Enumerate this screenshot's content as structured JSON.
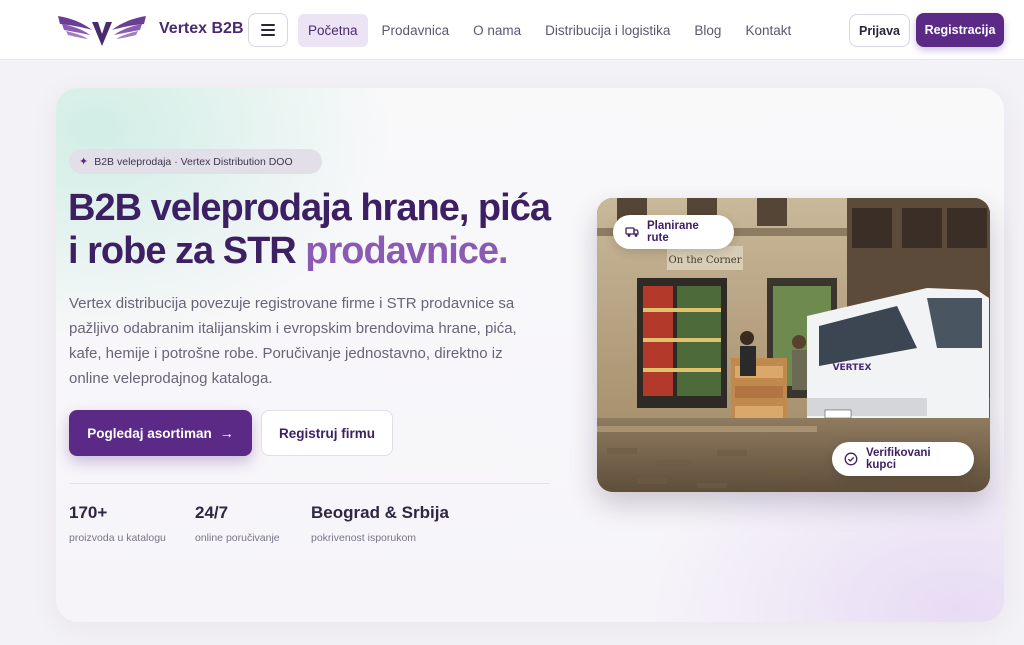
{
  "header": {
    "brand": "Vertex B2B",
    "logo_icon": "vertex-wings-logo",
    "menu_icon": "hamburger-icon",
    "nav": [
      {
        "label": "Početna",
        "active": true
      },
      {
        "label": "Prodavnica",
        "active": false
      },
      {
        "label": "O nama",
        "active": false
      },
      {
        "label": "Distribucija i logistika",
        "active": false
      },
      {
        "label": "Blog",
        "active": false
      },
      {
        "label": "Kontakt",
        "active": false
      }
    ],
    "login_label": "Prijava",
    "register_label": "Registracija"
  },
  "hero": {
    "badge": "B2B veleprodaja · Vertex Distribution DOO",
    "badge_icon": "sparkle-icon",
    "title_part1": "B2B veleprodaja hrane, pića i robe",
    "title_part2": "za STR",
    "title_accent": "prodavnice.",
    "lead": "Vertex distribucija povezuje registrovane firme i STR prodavnice sa pažljivo odabranim italijanskim i evropskim brendovima hrane, pića, kafe, hemije i potrošne robe. Poručivanje jednostavno, direktno iz online veleprodajnog kataloga.",
    "cta_primary": "Pogledaj asortiman",
    "cta_primary_icon": "arrow-right-icon",
    "cta_secondary": "Registruj firmu",
    "stats": [
      {
        "value": "170+",
        "label": "proizvoda u katalogu"
      },
      {
        "value": "24/7",
        "label": "online poručivanje"
      },
      {
        "value": "Beograd & Srbija",
        "label": "pokrivenost isporukom"
      }
    ],
    "photo": {
      "shop_sign": "On the Corner",
      "van_brand": "VERTEX",
      "chip_routes": "Planirane rute",
      "chip_routes_icon": "truck-icon",
      "chip_verified": "Verifikovani kupci",
      "chip_verified_icon": "check-circle-icon"
    }
  },
  "colors": {
    "primary": "#5b2a86",
    "title": "#3d1f63",
    "accent": "#8a5bb3",
    "nav_active_bg": "#ece4f4"
  }
}
